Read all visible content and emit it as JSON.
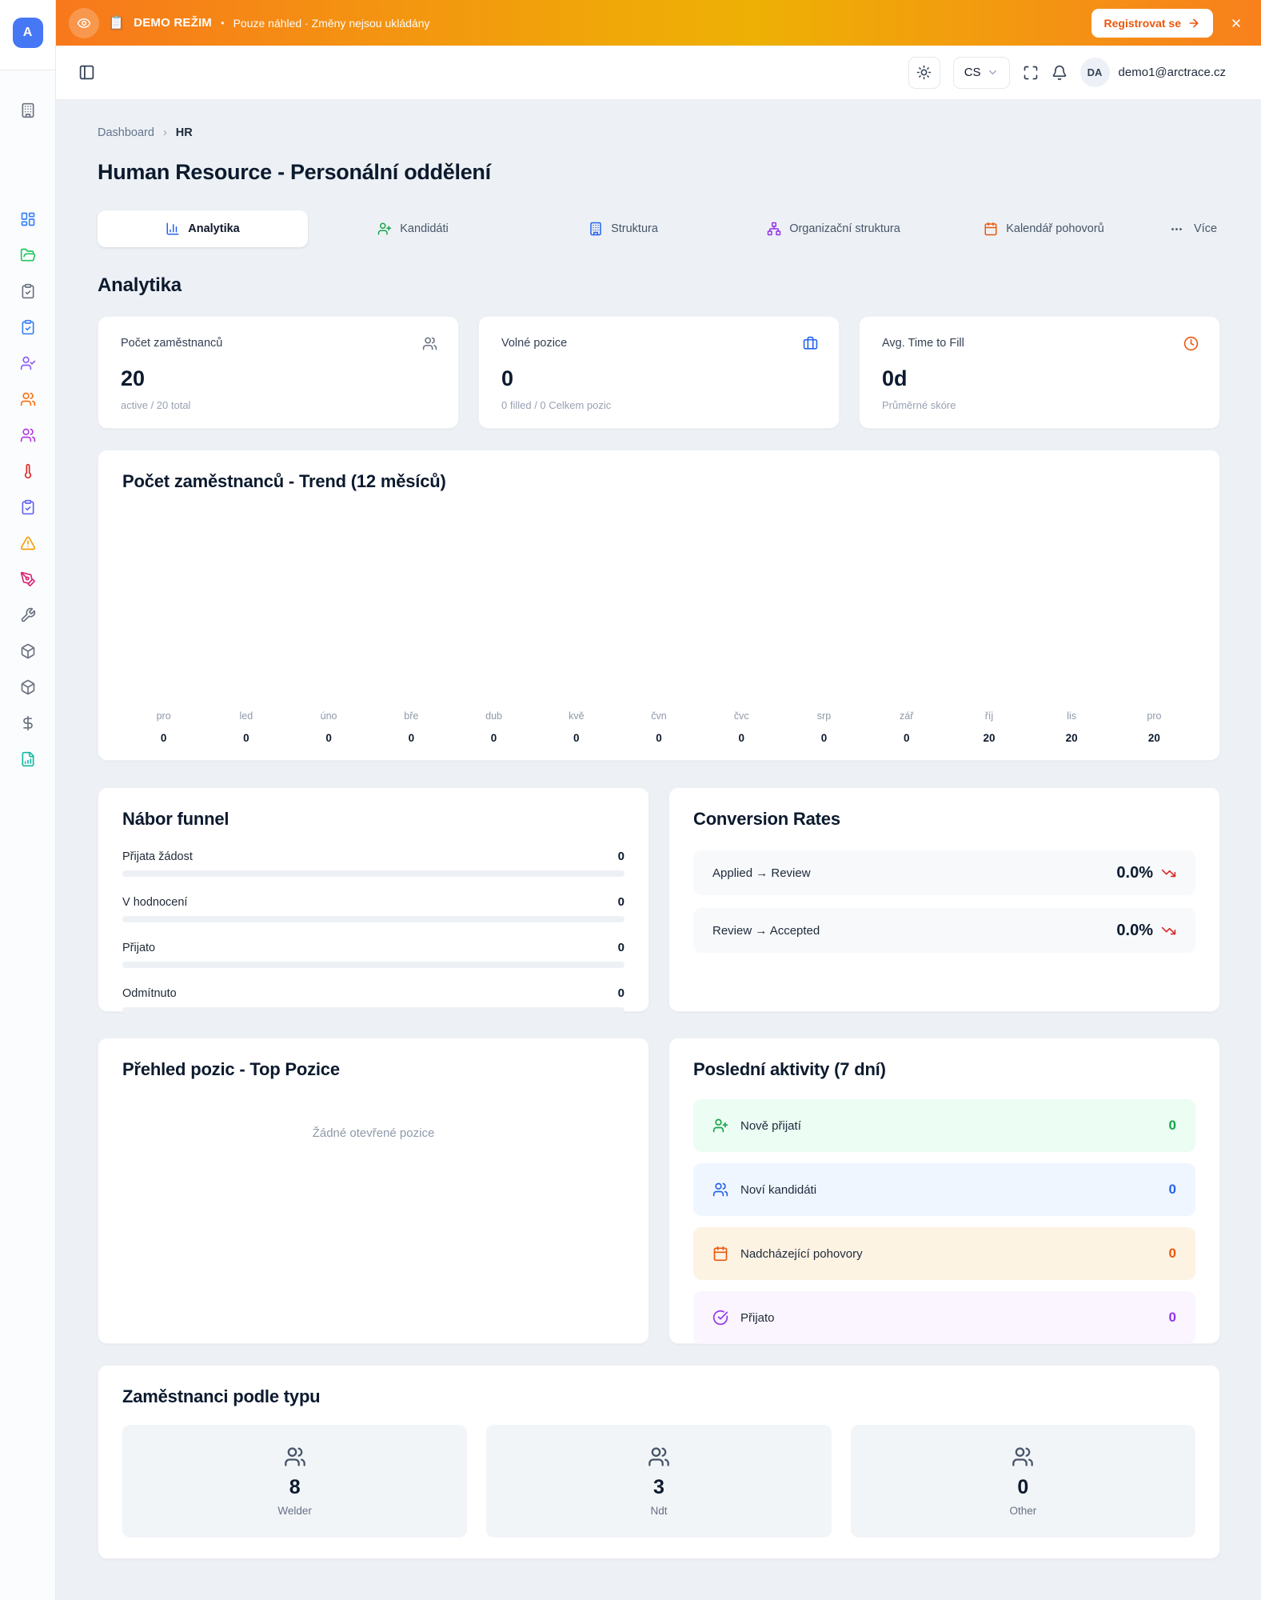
{
  "colors": {
    "accent_orange": "#f97316",
    "banner_yellow": "#f0ad05",
    "link_blue": "#2563eb",
    "negative_red": "#dc2626"
  },
  "banner": {
    "emoji": "📋",
    "mode_label": "DEMO REŽIM",
    "separator": "•",
    "subtitle": "Pouze náhled · Změny nejsou ukládány",
    "register_label": "Registrovat se"
  },
  "header": {
    "lang": "CS",
    "avatar_initials": "DA",
    "email": "demo1@arctrace.cz"
  },
  "sidebar": {
    "logo": "A",
    "nav_icons": [
      "building-icon",
      "dashboard-grid-icon",
      "folder-open-icon",
      "clipboard-check-gray-icon",
      "clipboard-check-blue-icon",
      "user-check-icon",
      "users-orange-icon",
      "users-purple-icon",
      "thermometer-icon",
      "clipboard-check-indigo-icon",
      "warning-triangle-icon",
      "pen-tool-icon",
      "wrench-icon",
      "box-icon",
      "box-icon",
      "dollar-icon",
      "file-chart-icon"
    ]
  },
  "breadcrumb": {
    "root": "Dashboard",
    "sep": "›",
    "current": "HR"
  },
  "page": {
    "title": "Human Resource - Personální oddělení"
  },
  "tabs": [
    {
      "label": "Analytika"
    },
    {
      "label": "Kandidáti"
    },
    {
      "label": "Struktura"
    },
    {
      "label": "Organizační struktura"
    },
    {
      "label": "Kalendář pohovorů"
    },
    {
      "label": "Více"
    }
  ],
  "section_heading": "Analytika",
  "stats": [
    {
      "title": "Počet zaměstnanců",
      "value": "20",
      "caption": "active / 20 total",
      "icon": "users-icon"
    },
    {
      "title": "Volné pozice",
      "value": "0",
      "caption": "0 filled / 0 Celkem pozic",
      "icon": "briefcase-icon"
    },
    {
      "title": "Avg. Time to Fill",
      "value": "0d",
      "caption": "Průměrné skóre",
      "icon": "clock-icon"
    }
  ],
  "chart_data": {
    "type": "line",
    "title": "Počet zaměstnanců - Trend (12 měsíců)",
    "x": [
      "pro",
      "led",
      "úno",
      "bře",
      "dub",
      "kvě",
      "čvn",
      "čvc",
      "srp",
      "zář",
      "říj",
      "lis",
      "pro"
    ],
    "series": [
      {
        "name": "Počet zaměstnanců",
        "values": [
          0,
          0,
          0,
          0,
          0,
          0,
          0,
          0,
          0,
          0,
          20,
          20,
          20
        ]
      }
    ],
    "layout": "plot area empty; month labels with value data-labels along bottom axis"
  },
  "funnel": {
    "title": "Nábor funnel",
    "rows": [
      {
        "label": "Přijata žádost",
        "value": "0"
      },
      {
        "label": "V hodnocení",
        "value": "0"
      },
      {
        "label": "Přijato",
        "value": "0"
      },
      {
        "label": "Odmítnuto",
        "value": "0"
      }
    ]
  },
  "conversion": {
    "title": "Conversion Rates",
    "rows": [
      {
        "label": "Applied → Review",
        "value": "0.0%"
      },
      {
        "label": "Review → Accepted",
        "value": "0.0%"
      }
    ]
  },
  "positions": {
    "title": "Přehled pozic - Top Pozice",
    "empty": "Žádné otevřené pozice"
  },
  "activities": {
    "title": "Poslední aktivity (7 dní)",
    "rows": [
      {
        "label": "Nově přijatí",
        "value": "0",
        "color": "green",
        "icon": "user-plus-icon"
      },
      {
        "label": "Noví kandidáti",
        "value": "0",
        "color": "blue",
        "icon": "users-icon"
      },
      {
        "label": "Nadcházející pohovory",
        "value": "0",
        "color": "orange",
        "icon": "calendar-icon"
      },
      {
        "label": "Přijato",
        "value": "0",
        "color": "purple",
        "icon": "check-circle-icon"
      }
    ]
  },
  "employee_types": {
    "title": "Zaměstnanci podle typu",
    "tiles": [
      {
        "value": "8",
        "label": "Welder"
      },
      {
        "value": "3",
        "label": "Ndt"
      },
      {
        "value": "0",
        "label": "Other"
      }
    ]
  }
}
